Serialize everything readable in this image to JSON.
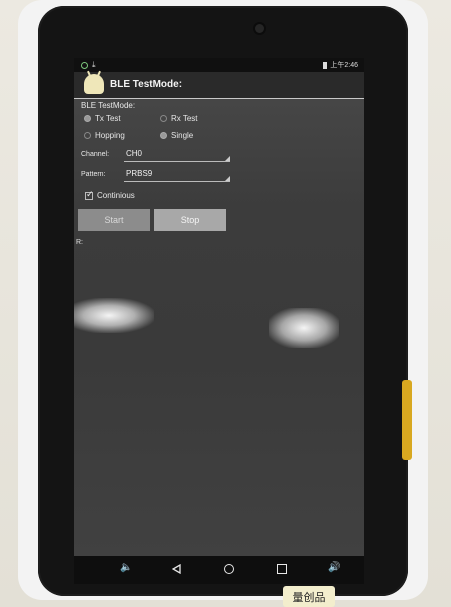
{
  "status_bar": {
    "time": "上午2:46"
  },
  "action_bar": {
    "title": "BLE TestMode:"
  },
  "form": {
    "section_label": "BLE TestMode:",
    "test_mode": [
      {
        "label": "Tx Test",
        "selected": true
      },
      {
        "label": "Rx Test",
        "selected": false
      }
    ],
    "hop_mode": [
      {
        "label": "Hopping",
        "selected": false
      },
      {
        "label": "Single",
        "selected": true
      }
    ],
    "channel": {
      "label": "Channel:",
      "value": "CH0"
    },
    "pattern": {
      "label": "Pattern:",
      "value": "PRBS9"
    },
    "continuous": {
      "label": "Continious",
      "checked": true
    },
    "start_label": "Start",
    "stop_label": "Stop",
    "result_label": "R:"
  },
  "sticker": {
    "text": "量创品"
  },
  "icons": {
    "status_left": [
      "sync-icon",
      "download-icon"
    ],
    "status_right": [
      "battery-icon"
    ],
    "nav": [
      "volume-down-icon",
      "back-icon",
      "home-icon",
      "recents-icon",
      "volume-up-icon"
    ]
  },
  "colors": {
    "screen_bg": "#3e3e3e",
    "button_start": "#8c8c8c",
    "button_stop": "#a8a8a8",
    "tablet_frame": "#141414"
  }
}
